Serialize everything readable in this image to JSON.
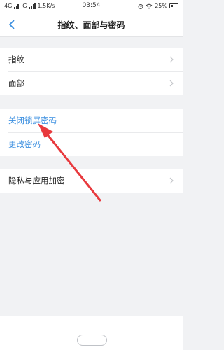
{
  "status_bar": {
    "network_1": "4G",
    "network_2": "G",
    "speed": "1.5K/s",
    "time": "03:54",
    "battery": "25%"
  },
  "header": {
    "title": "指纹、面部与密码"
  },
  "groups": [
    {
      "items": [
        {
          "label": "指纹"
        },
        {
          "label": "面部"
        }
      ]
    },
    {
      "items": [
        {
          "label": "关闭锁屏密码"
        },
        {
          "label": "更改密码"
        }
      ]
    },
    {
      "items": [
        {
          "label": "隐私与应用加密"
        }
      ]
    }
  ],
  "icons": [
    "back-icon",
    "chevron-right-icon",
    "wifi-icon",
    "alarm-icon",
    "battery-icon"
  ],
  "colors": {
    "link": "#3b8fe0",
    "annotation_arrow": "#e8393d",
    "background": "#f1f2f4"
  }
}
